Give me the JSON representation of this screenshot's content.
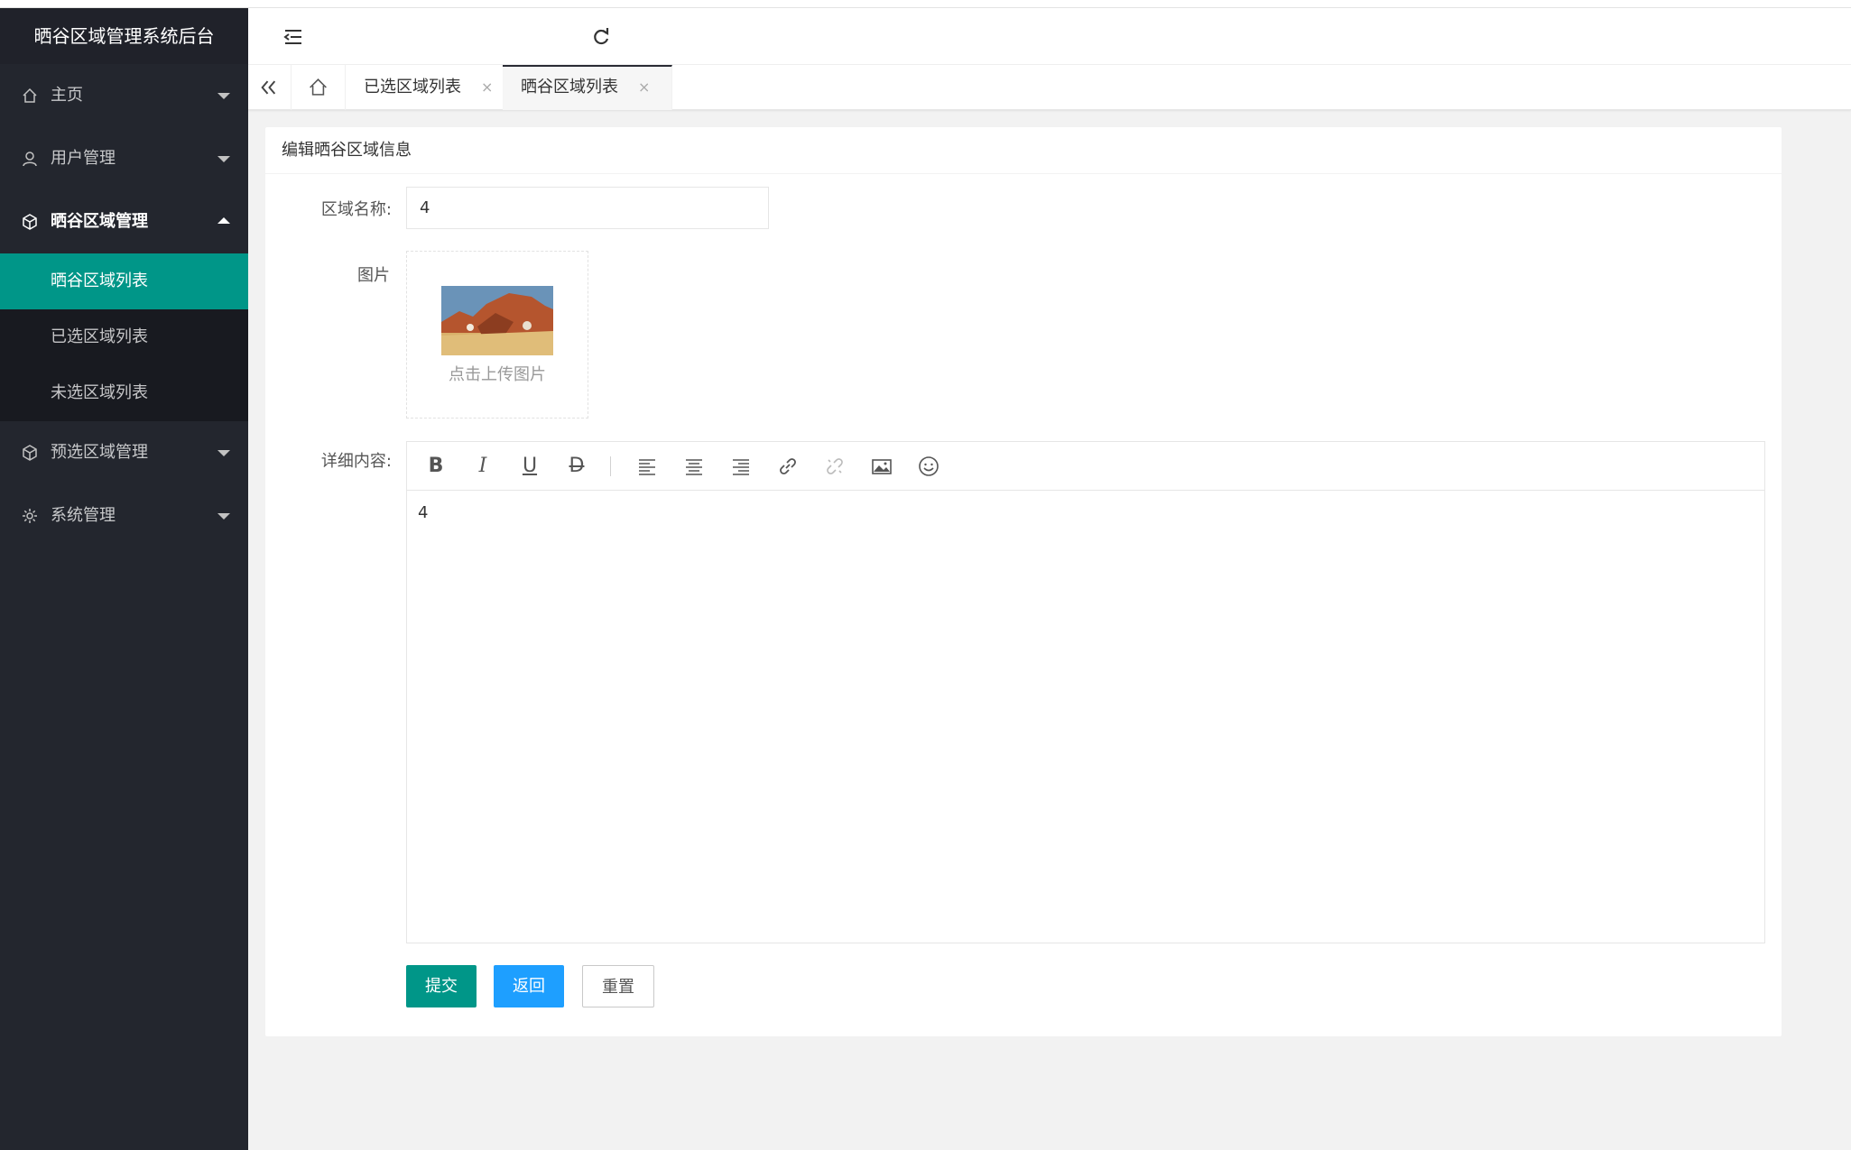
{
  "app": {
    "title": "晒谷区域管理系统后台"
  },
  "sidebar": {
    "items": [
      {
        "label": "主页",
        "icon": "home-icon"
      },
      {
        "label": "用户管理",
        "icon": "user-icon"
      },
      {
        "label": "晒谷区域管理",
        "icon": "cube-icon",
        "open": true,
        "children": [
          {
            "label": "晒谷区域列表",
            "active": true
          },
          {
            "label": "已选区域列表"
          },
          {
            "label": "未选区域列表"
          }
        ]
      },
      {
        "label": "预选区域管理",
        "icon": "cube-icon"
      },
      {
        "label": "系统管理",
        "icon": "gear-icon"
      }
    ]
  },
  "tabs": [
    {
      "label": "已选区域列表"
    },
    {
      "label": "晒谷区域列表",
      "active": true
    }
  ],
  "form": {
    "card_title": "编辑晒谷区域信息",
    "name_label": "区域名称:",
    "name_value": "4",
    "image_label": "图片",
    "upload_text": "点击上传图片",
    "detail_label": "详细内容:",
    "detail_value": "4",
    "submit_label": "提交",
    "back_label": "返回",
    "reset_label": "重置"
  },
  "colors": {
    "accent": "#009688",
    "blue": "#1e9fff",
    "sidebar_bg": "#23262e"
  }
}
